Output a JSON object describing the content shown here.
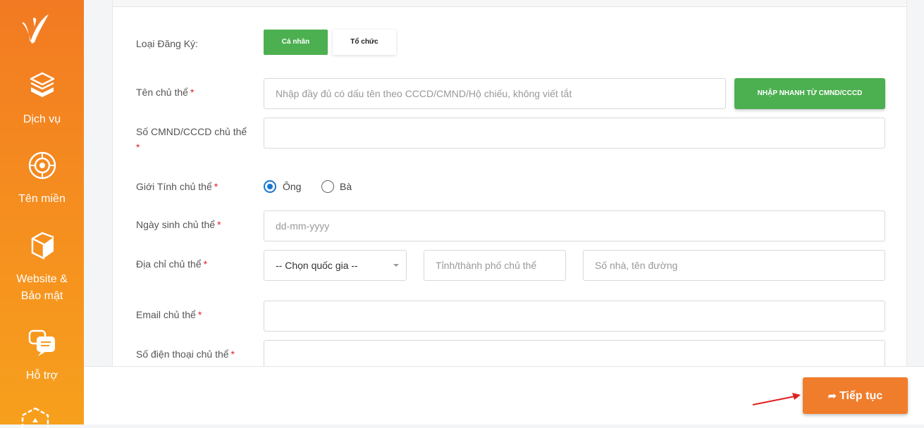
{
  "sidebar": {
    "items": [
      {
        "label": "Dịch vụ",
        "icon": "layers-icon"
      },
      {
        "label": "Tên miền",
        "icon": "globe-icon"
      },
      {
        "label_line1": "Website &",
        "label_line2": "Bảo mật",
        "icon": "book-shield-icon"
      },
      {
        "label": "Hỗ trợ",
        "icon": "chat-icon"
      }
    ]
  },
  "form": {
    "registration_type": {
      "label": "Loại Đăng Ký:",
      "options": [
        "Cá nhân",
        "Tổ chức"
      ],
      "selected": "Cá nhân"
    },
    "owner_name": {
      "label": "Tên chủ thể",
      "placeholder": "Nhập đầy đủ có dấu tên theo CCCD/CMND/Hộ chiếu, không viết tắt"
    },
    "quick_fill_button": "NHẬP NHANH TỪ CMND/CCCD",
    "id_number": {
      "label": "Số CMND/CCCD chủ thể",
      "value": ""
    },
    "gender": {
      "label": "Giới Tính chủ thể",
      "options": [
        "Ông",
        "Bà"
      ],
      "selected": "Ông"
    },
    "birthdate": {
      "label": "Ngày sinh chủ thể",
      "placeholder": "dd-mm-yyyy"
    },
    "address": {
      "label": "Địa chỉ chủ thể",
      "country_select": "-- Chọn quốc gia --",
      "city_placeholder": "Tỉnh/thành phố chủ thể",
      "street_placeholder": "Số nhà, tên đường"
    },
    "email": {
      "label": "Email chủ thể",
      "value": ""
    },
    "phone": {
      "label": "Số điện thoại chủ thể",
      "value": ""
    },
    "required_mark": "*"
  },
  "footer": {
    "next_button": "Tiếp tục"
  },
  "colors": {
    "sidebar_top": "#f27a22",
    "sidebar_bottom": "#f7a01d",
    "green": "#4caf50",
    "orange_button": "#f07d2b",
    "required": "#e02020",
    "radio": "#1976d2"
  }
}
